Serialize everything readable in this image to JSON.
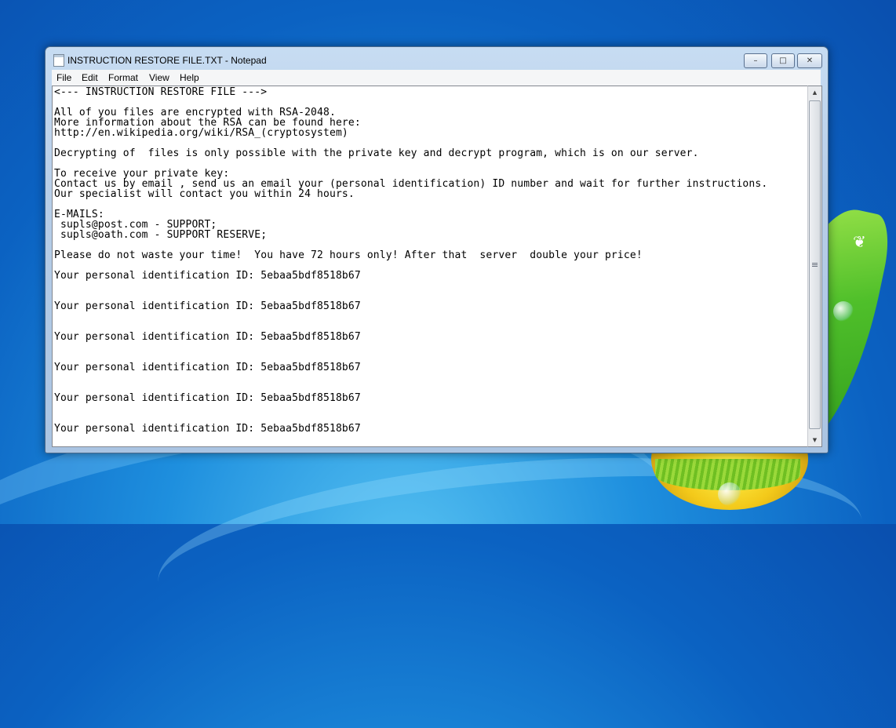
{
  "window": {
    "title": "INSTRUCTION RESTORE FILE.TXT - Notepad",
    "controls": {
      "minimize": "–",
      "maximize": "□",
      "close": "✕"
    }
  },
  "menu": [
    "File",
    "Edit",
    "Format",
    "View",
    "Help"
  ],
  "document": {
    "lines": [
      "<--- INSTRUCTION RESTORE FILE --->",
      "",
      "All of you files are encrypted with RSA-2048.",
      "More information about the RSA can be found here:",
      "http://en.wikipedia.org/wiki/RSA_(cryptosystem)",
      "",
      "Decrypting of  files is only possible with the private key and decrypt program, which is on our server.",
      "",
      "To receive your private key:",
      "Contact us by email , send us an email your (personal identification) ID number and wait for further instructions.",
      "Our specialist will contact you within 24 hours.",
      "",
      "E-MAILS:",
      " supls@post.com - SUPPORT;",
      " supls@oath.com - SUPPORT RESERVE;",
      "",
      "Please do not waste your time!  You have 72 hours only! After that  server  double your price!",
      "",
      "Your personal identification ID: 5ebaa5bdf8518b67",
      "",
      "",
      "Your personal identification ID: 5ebaa5bdf8518b67",
      "",
      "",
      "Your personal identification ID: 5ebaa5bdf8518b67",
      "",
      "",
      "Your personal identification ID: 5ebaa5bdf8518b67",
      "",
      "",
      "Your personal identification ID: 5ebaa5bdf8518b67",
      "",
      "",
      "Your personal identification ID: 5ebaa5bdf8518b67"
    ]
  },
  "scrollbar": {
    "up": "▲",
    "down": "▼"
  }
}
